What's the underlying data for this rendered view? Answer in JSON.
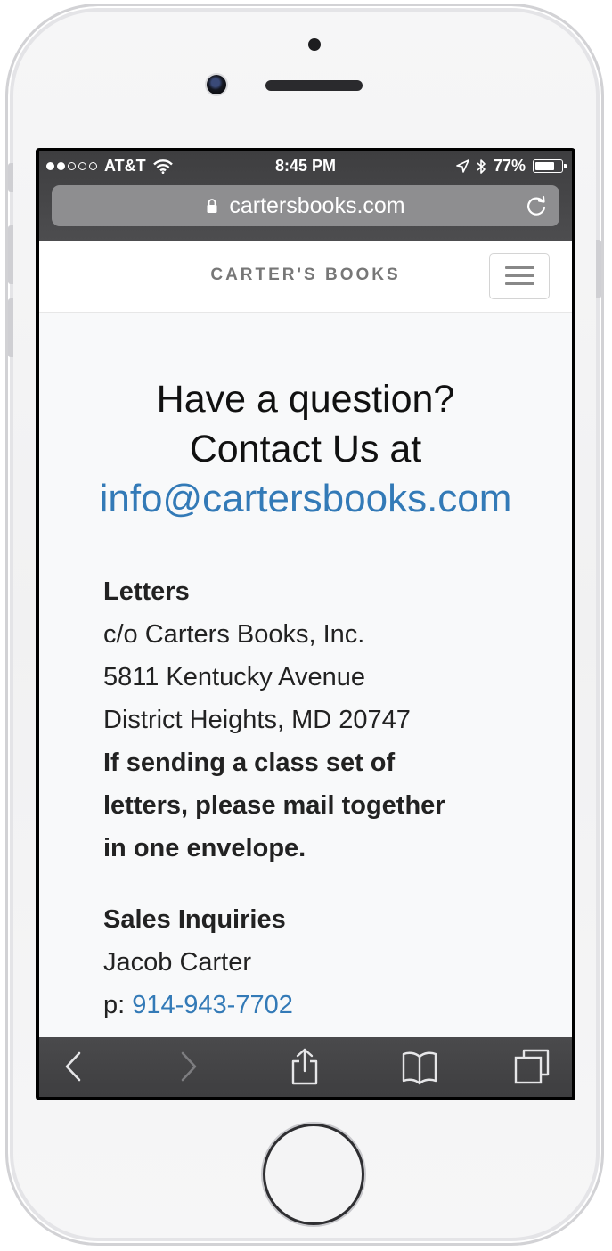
{
  "status_bar": {
    "carrier": "AT&T",
    "time": "8:45 PM",
    "battery_percent": "77%",
    "battery_level": 0.77,
    "signal_bars_filled": 2,
    "signal_bars_total": 5
  },
  "address_bar": {
    "url": "cartersbooks.com"
  },
  "site": {
    "brand": "CARTER'S BOOKS"
  },
  "contact": {
    "line1": "Have a question?",
    "line2": "Contact Us at",
    "email": "info@cartersbooks.com"
  },
  "letters": {
    "title": "Letters",
    "line1": "c/o Carters Books, Inc.",
    "line2": "5811 Kentucky Avenue",
    "line3": "District Heights, MD 20747",
    "note_line1": "If sending a class set of",
    "note_line2": "letters, please mail together",
    "note_line3": "in one envelope."
  },
  "sales": {
    "title": "Sales Inquiries",
    "name": "Jacob Carter",
    "phone_prefix": "p:",
    "phone": "914-943-7702"
  },
  "colors": {
    "link": "#337ab7",
    "brand_text": "#777777",
    "safari_chrome": "#424244"
  },
  "icons": {
    "back": "chevron-left-icon",
    "forward": "chevron-right-icon",
    "share": "share-icon",
    "bookmarks": "book-icon",
    "tabs": "tabs-icon"
  }
}
